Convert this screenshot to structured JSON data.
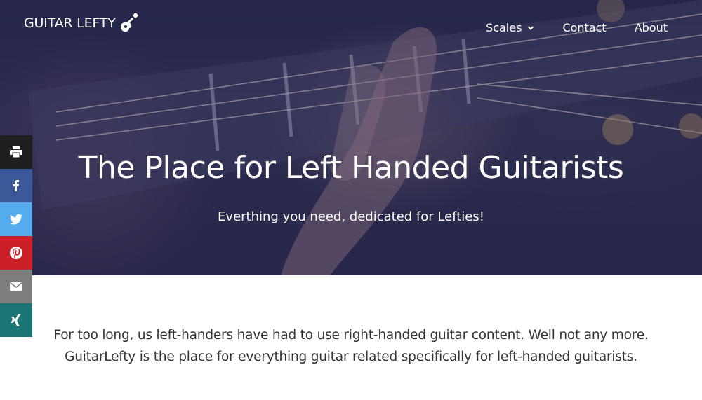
{
  "header": {
    "logo_text": "GUITAR LEFTY",
    "logo_icon": "guitar-icon",
    "nav": [
      {
        "label": "Scales",
        "has_dropdown": true
      },
      {
        "label": "Contact"
      },
      {
        "label": "About"
      }
    ]
  },
  "hero": {
    "title": "The Place for Left Handed Guitarists",
    "subtitle": "Everthing you need, dedicated for Lefties!"
  },
  "share_bar": [
    {
      "icon": "print-icon",
      "color": "#1f1f1f"
    },
    {
      "icon": "facebook-icon",
      "color": "#3b5998"
    },
    {
      "icon": "twitter-icon",
      "color": "#55acee"
    },
    {
      "icon": "pinterest-icon",
      "color": "#cb2027"
    },
    {
      "icon": "email-icon",
      "color": "#7d7d7d"
    },
    {
      "icon": "xing-icon",
      "color": "#1a7576"
    }
  ],
  "intro": {
    "line1": "For too long, us left-handers have had to use right-handed guitar content. Well not any more.",
    "line2": "GuitarLefty is the place for everything guitar related specifically for left-handed guitarists."
  }
}
